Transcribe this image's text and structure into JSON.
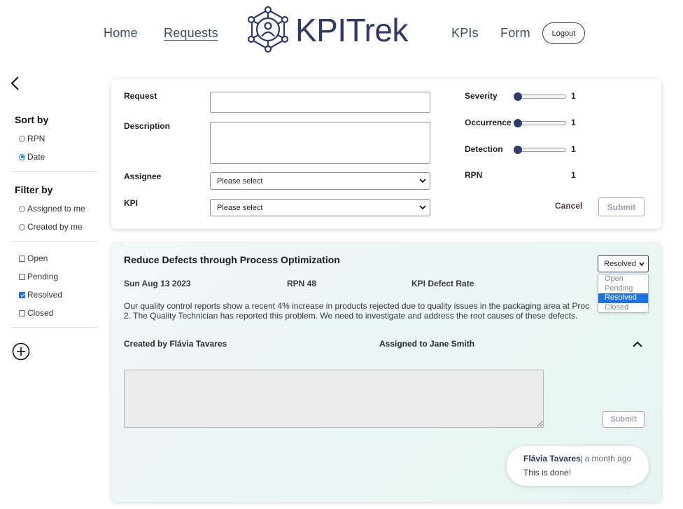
{
  "nav": {
    "home": "Home",
    "requests": "Requests",
    "logo_text": "KPITrek",
    "kpis": "KPIs",
    "form": "Form",
    "logout": "Logout"
  },
  "sidebar": {
    "sort_by": "Sort by",
    "sort_options": [
      {
        "label": "RPN",
        "checked": false
      },
      {
        "label": "Date",
        "checked": true
      }
    ],
    "filter_by": "Filter by",
    "filter_options": [
      {
        "label": "Assigned to me",
        "checked": false
      },
      {
        "label": "Created by me",
        "checked": false
      }
    ],
    "status_options": [
      {
        "label": "Open",
        "checked": false
      },
      {
        "label": "Pending",
        "checked": false
      },
      {
        "label": "Resolved",
        "checked": true
      },
      {
        "label": "Closed",
        "checked": false
      }
    ]
  },
  "form": {
    "request_label": "Request",
    "request_value": "",
    "description_label": "Description",
    "description_value": "",
    "assignee_label": "Assignee",
    "assignee_value": "Please select",
    "kpi_label": "KPI",
    "kpi_value": "Please select",
    "severity_label": "Severity",
    "severity_value": "1",
    "occurrence_label": "Occurrence",
    "occurrence_value": "1",
    "detection_label": "Detection",
    "detection_value": "1",
    "rpn_label": "RPN",
    "rpn_value": "1",
    "cancel": "Cancel",
    "submit": "Submit"
  },
  "request": {
    "title": "Reduce Defects through Process Optimization",
    "date": "Sun Aug 13 2023",
    "rpn": "RPN 48",
    "kpi": "KPI Defect Rate",
    "description_line1": "Our quality control reports show a recent 4% increase in products rejected due to quality issues in the packaging area at Proc",
    "description_line2": "2. The Quality Technician has reported this problem. We need to investigate and address the root causes of these defects.",
    "created_by": "Created by Flávia Tavares",
    "assigned_to": "Assigned to Jane Smith",
    "status_value": "Resolved",
    "status_options": [
      "Open",
      "Pending",
      "Resolved",
      "Closed"
    ],
    "submit": "Submit",
    "comment": {
      "author": "Flávia Tavares",
      "time": "| a month ago",
      "text": "This is done!"
    }
  },
  "colors": {
    "brand": "#2f3b66",
    "accent": "#1a73e8",
    "card_tint": "#eaf6f3"
  }
}
